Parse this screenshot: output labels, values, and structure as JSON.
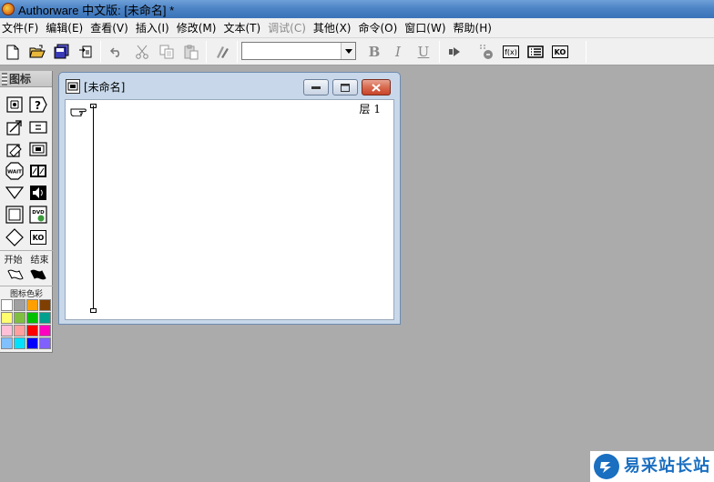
{
  "window": {
    "title": "Authorware 中文版: [未命名] *"
  },
  "menubar": {
    "items": [
      {
        "label": "文件(F)",
        "enabled": true
      },
      {
        "label": "编辑(E)",
        "enabled": true
      },
      {
        "label": "查看(V)",
        "enabled": true
      },
      {
        "label": "插入(I)",
        "enabled": true
      },
      {
        "label": "修改(M)",
        "enabled": true
      },
      {
        "label": "文本(T)",
        "enabled": true
      },
      {
        "label": "调试(C)",
        "enabled": false
      },
      {
        "label": "其他(X)",
        "enabled": true
      },
      {
        "label": "命令(O)",
        "enabled": true
      },
      {
        "label": "窗口(W)",
        "enabled": true
      },
      {
        "label": "帮助(H)",
        "enabled": true
      }
    ]
  },
  "toolbar": {
    "style_combo_value": "",
    "bold_label": "B",
    "italic_label": "I",
    "underline_label": "U",
    "icons": [
      "new-icon",
      "open-icon",
      "save-all-icon",
      "import-icon",
      "undo-icon",
      "cut-icon",
      "copy-icon",
      "paste-icon",
      "find-icon",
      "bold-icon",
      "italic-icon",
      "underline-icon",
      "run-icon",
      "control-panel-icon",
      "functions-icon",
      "variables-icon",
      "knowledge-objects-icon"
    ],
    "functions_label": "f(x)",
    "ko_label": "KO"
  },
  "palette": {
    "title": "图标",
    "start_label": "开始",
    "end_label": "结束",
    "color_label": "图标色彩",
    "icons": [
      "display-icon",
      "interaction-icon",
      "motion-icon",
      "calculation-icon",
      "erase-icon",
      "map-icon",
      "wait-icon",
      "digital-movie-icon",
      "navigate-icon",
      "sound-icon",
      "framework-icon",
      "video-icon",
      "decision-icon",
      "knowledge-object-icon"
    ],
    "wait_text": "WAIT",
    "dvd_text": "DVD",
    "ko_text": "KO",
    "colors": [
      "#ffffff",
      "#a0a0a0",
      "#ff9f00",
      "#7f3f00",
      "#ffff6f",
      "#7fbf3f",
      "#00c000",
      "#00a08f",
      "#ffc0d8",
      "#ff9f9f",
      "#ff0000",
      "#ff00c0",
      "#80c0ff",
      "#00e0ff",
      "#0000ff",
      "#8060ff"
    ]
  },
  "design_window": {
    "title": "[未命名]",
    "layer_label": "层 1"
  },
  "watermark": {
    "text": "易采站长站"
  }
}
